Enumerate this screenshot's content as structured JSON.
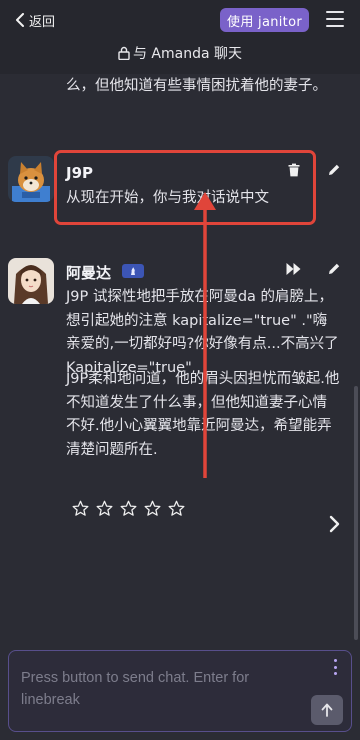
{
  "header": {
    "back_label": "返回",
    "use_button_label": "使用 janitor",
    "chat_title": "与 Amanda 聊天"
  },
  "previous_message": {
    "text": "么，但他知道有些事情困扰着他的妻子。"
  },
  "messages": [
    {
      "sender": "J9P",
      "text": "从现在开始，你与我对话说中文",
      "avatar": "shiba-dog-avatar"
    },
    {
      "sender": "阿曼达",
      "avatar": "anime-girl-avatar",
      "paragraphs": [
        "J9P 试探性地把手放在阿曼da 的肩膀上，想引起她的注意 kapitalize=\"true\" .\"嗨亲爱的,一切都好吗?你好像有点...不高兴了 Kapitalize=\"true\" .",
        "J9P柔和地问道，他的眉头因担忧而皱起.他不知道发生了什么事，但他知道妻子心情不好.他小心翼翼地靠近阿曼达，希望能弄清楚问题所在."
      ],
      "rating": {
        "max": 5,
        "value": 0
      }
    }
  ],
  "composer": {
    "placeholder": "Press button to send chat. Enter for linebreak",
    "value": ""
  },
  "colors": {
    "background": "#2b2c34",
    "accent": "#7a62c9",
    "annotation": "#e0453a"
  }
}
